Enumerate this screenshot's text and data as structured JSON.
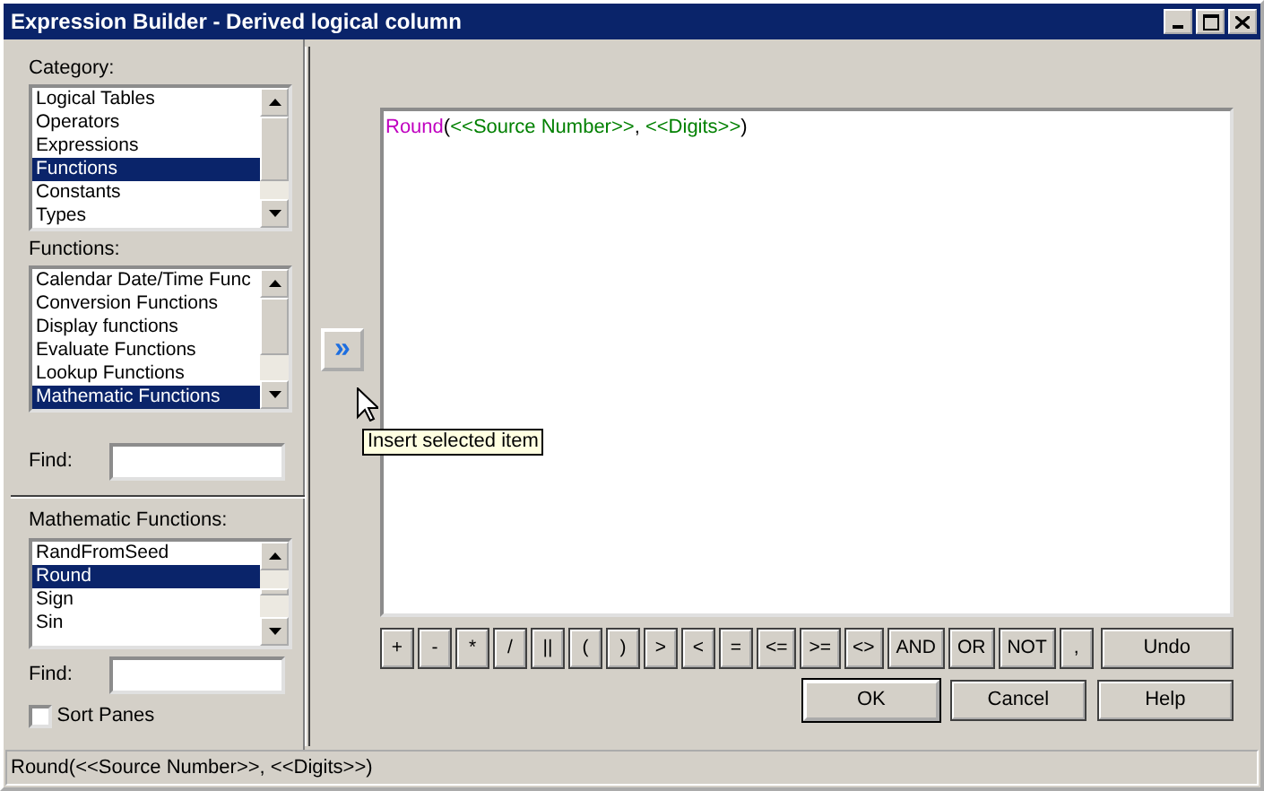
{
  "window": {
    "title": "Expression Builder - Derived logical column"
  },
  "category": {
    "label": "Category:",
    "items": [
      {
        "text": "Logical Tables",
        "selected": false
      },
      {
        "text": "Operators",
        "selected": false
      },
      {
        "text": "Expressions",
        "selected": false
      },
      {
        "text": "Functions",
        "selected": true
      },
      {
        "text": "Constants",
        "selected": false
      },
      {
        "text": "Types",
        "selected": false
      }
    ]
  },
  "functions": {
    "label": "Functions:",
    "items": [
      {
        "text": "Calendar Date/Time Func",
        "selected": false
      },
      {
        "text": "Conversion Functions",
        "selected": false
      },
      {
        "text": "Display functions",
        "selected": false
      },
      {
        "text": "Evaluate Functions",
        "selected": false
      },
      {
        "text": "Lookup Functions",
        "selected": false
      },
      {
        "text": "Mathematic Functions",
        "selected": true
      }
    ]
  },
  "find_1": {
    "label": "Find:"
  },
  "math_functions": {
    "label": "Mathematic Functions:",
    "items": [
      {
        "text": "RandFromSeed",
        "selected": false
      },
      {
        "text": "Round",
        "selected": true
      },
      {
        "text": "Sign",
        "selected": false
      },
      {
        "text": "Sin",
        "selected": false
      }
    ]
  },
  "find_2": {
    "label": "Find:"
  },
  "sort_panes": {
    "label": "Sort Panes",
    "checked": false
  },
  "insert_button": {
    "glyph": "»"
  },
  "tooltip": "Insert selected item",
  "expression": [
    {
      "kind": "function",
      "text": "Round"
    },
    {
      "kind": "punct",
      "text": "("
    },
    {
      "kind": "param",
      "text": "<<Source Number>>"
    },
    {
      "kind": "punct",
      "text": ", "
    },
    {
      "kind": "param",
      "text": "<<Digits>>"
    },
    {
      "kind": "punct",
      "text": ")"
    }
  ],
  "operators": [
    "+",
    "-",
    "*",
    "/",
    "||",
    "(",
    ")",
    ">",
    "<",
    "=",
    "<=",
    ">=",
    "<>",
    "AND",
    "OR",
    "NOT",
    ","
  ],
  "undo": {
    "label": "Undo"
  },
  "buttons": [
    {
      "label": "OK",
      "default": true
    },
    {
      "label": "Cancel",
      "default": false
    },
    {
      "label": "Help",
      "default": false
    }
  ],
  "status_bar": "Round(<<Source Number>>, <<Digits>>)"
}
